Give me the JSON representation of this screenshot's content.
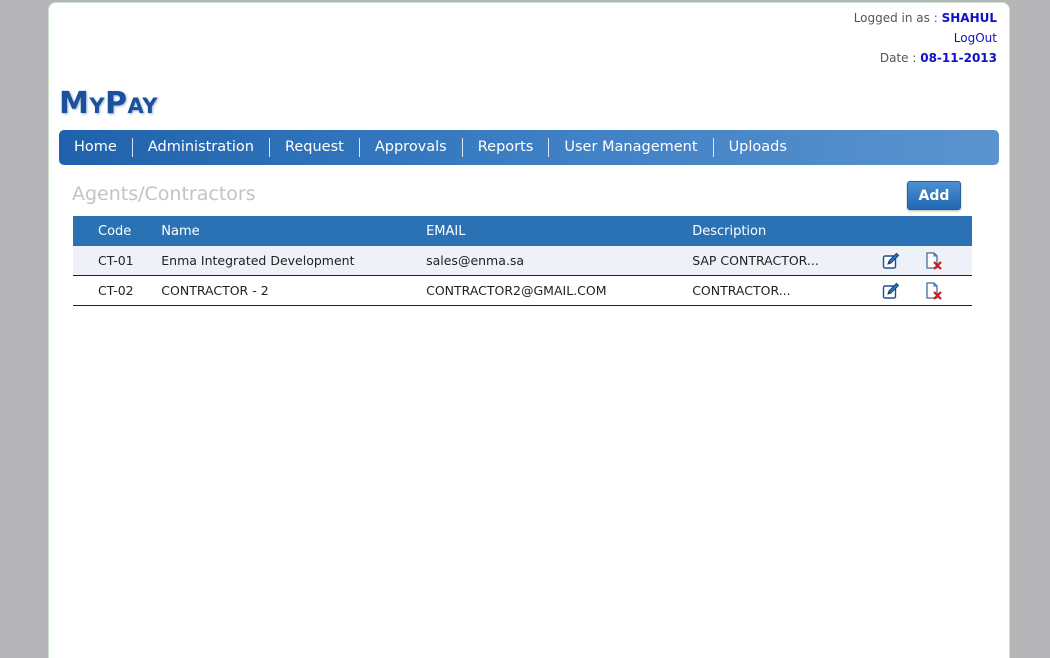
{
  "user": {
    "logged_in_label": "Logged in as : ",
    "username": "SHAHUL",
    "logout": "LogOut",
    "date_label": "Date : ",
    "date": "08-11-2013"
  },
  "app": {
    "logo": "MyPay"
  },
  "nav": {
    "items": [
      "Home",
      "Administration",
      "Request",
      "Approvals",
      "Reports",
      "User Management",
      "Uploads"
    ]
  },
  "section": {
    "title": "Agents/Contractors",
    "add_label": "Add"
  },
  "table": {
    "headers": [
      "Code",
      "Name",
      "EMAIL",
      "Description"
    ],
    "rows": [
      [
        "CT-01",
        "Enma Integrated Development",
        "sales@enma.sa",
        "SAP CONTRACTOR..."
      ],
      [
        "CT-02",
        "CONTRACTOR - 2",
        "CONTRACTOR2@GMAIL.COM",
        "CONTRACTOR..."
      ]
    ]
  },
  "icons": {
    "edit": "edit-icon",
    "delete": "delete-icon"
  },
  "colors": {
    "brand": "#1c4f9c",
    "nav_bar": "#2a72b4",
    "highlight": "#1010c8"
  }
}
